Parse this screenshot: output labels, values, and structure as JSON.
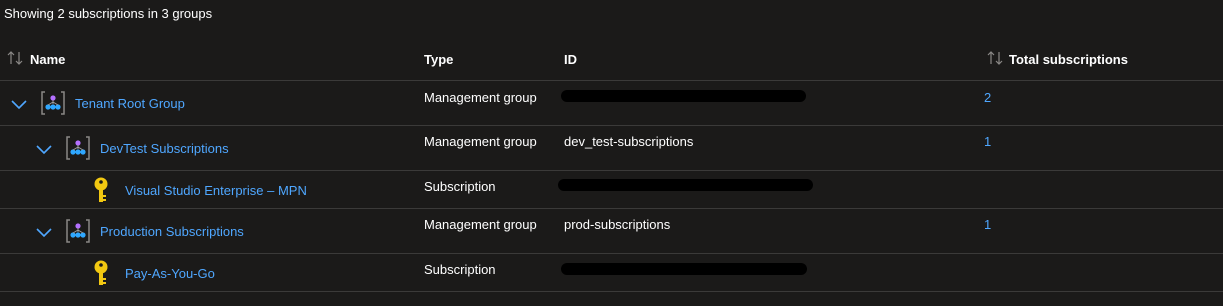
{
  "summary": "Showing 2 subscriptions in 3 groups",
  "columns": {
    "name": "Name",
    "type": "Type",
    "id": "ID",
    "total": "Total subscriptions"
  },
  "rows": [
    {
      "name": "Tenant Root Group",
      "type": "Management group",
      "id": "",
      "total": "2",
      "icon": "management-group-icon",
      "expanded": true
    },
    {
      "name": "DevTest Subscriptions",
      "type": "Management group",
      "id": "dev_test-subscriptions",
      "total": "1",
      "icon": "management-group-icon",
      "expanded": true
    },
    {
      "name": "Visual Studio Enterprise – MPN",
      "type": "Subscription",
      "id": "",
      "total": "",
      "icon": "key-icon"
    },
    {
      "name": "Production Subscriptions",
      "type": "Management group",
      "id": "prod-subscriptions",
      "total": "1",
      "icon": "management-group-icon",
      "expanded": true
    },
    {
      "name": "Pay-As-You-Go",
      "type": "Subscription",
      "id": "",
      "total": "",
      "icon": "key-icon"
    }
  ],
  "colors": {
    "background": "#1b1a19",
    "link": "#4fa7ff",
    "divider": "#3b3a39",
    "key": "#f2c811"
  }
}
